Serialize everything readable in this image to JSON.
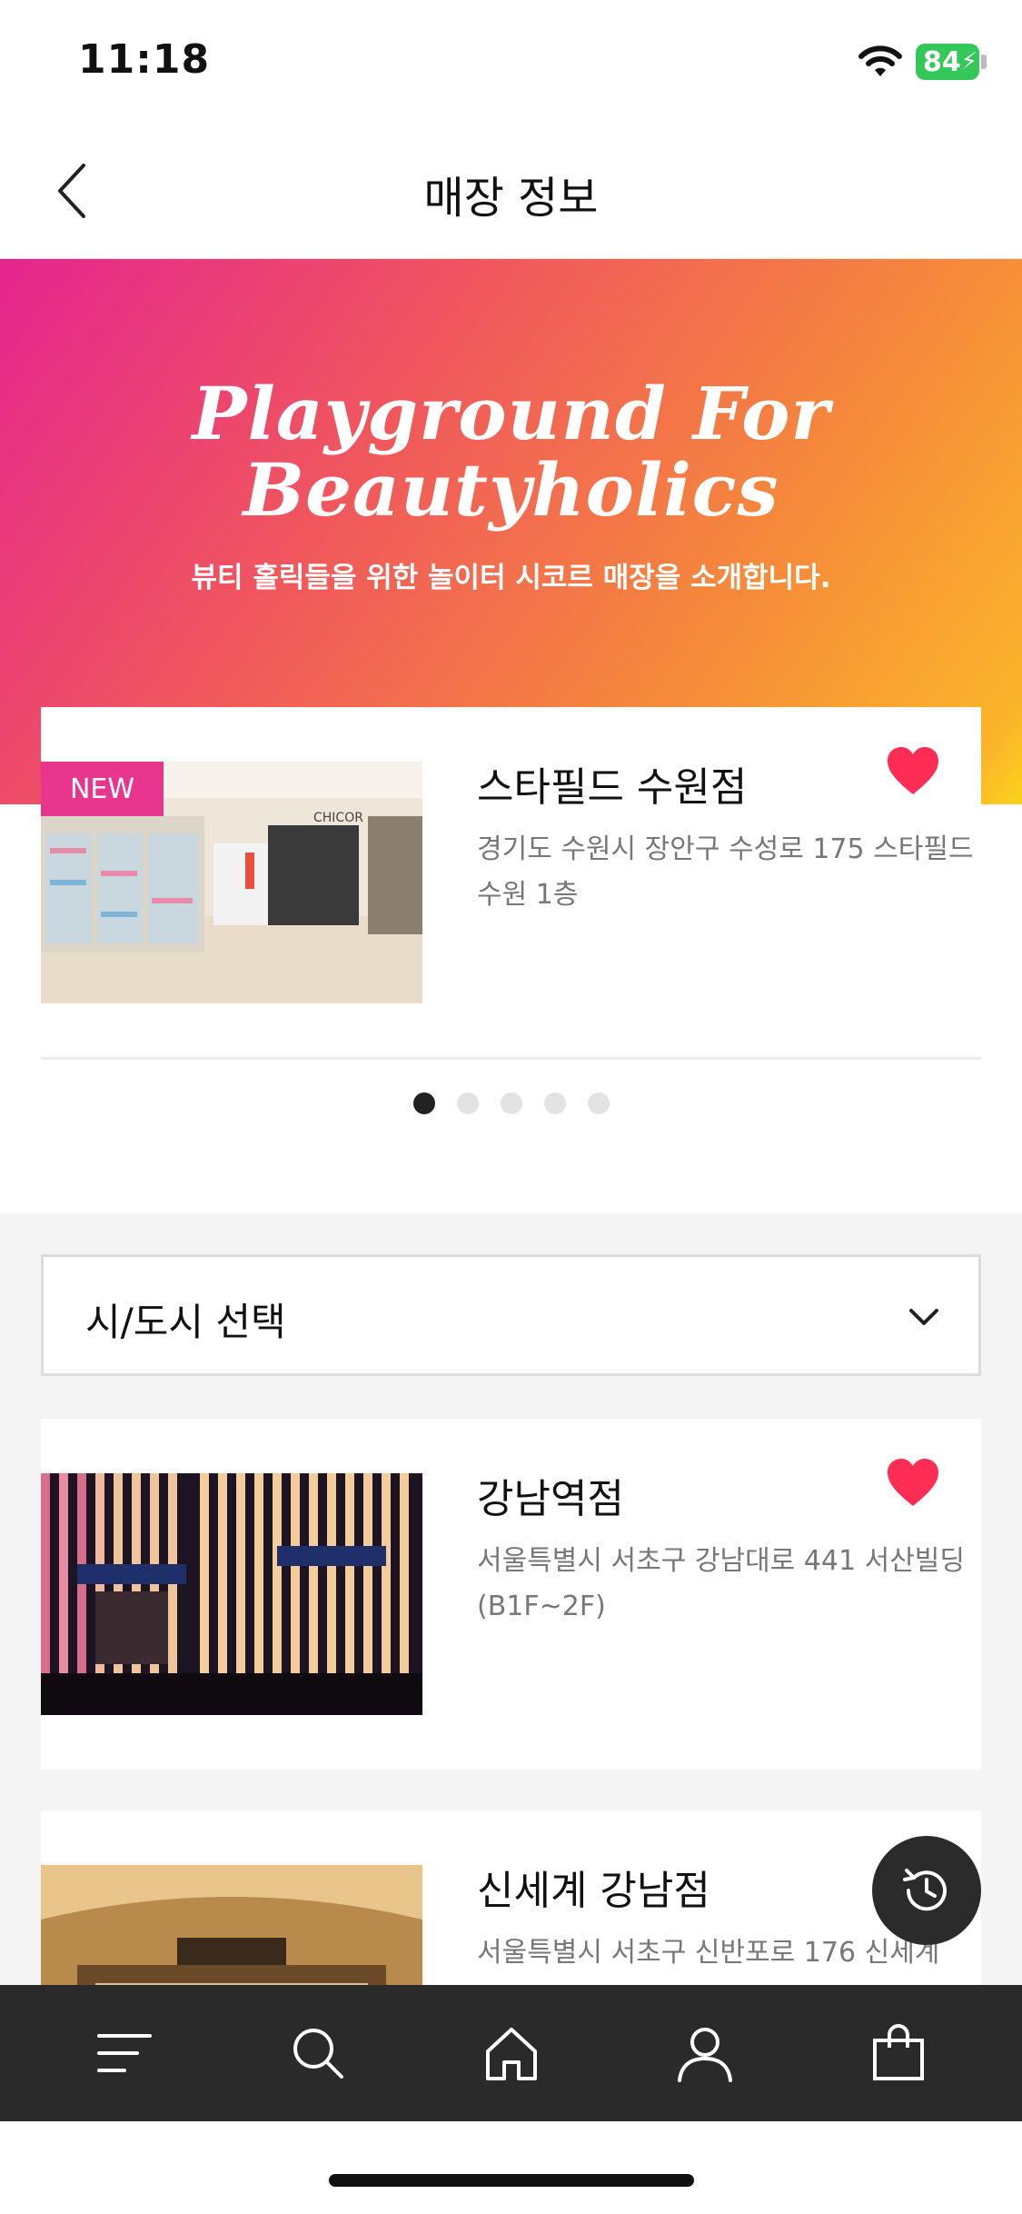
{
  "status_bar": {
    "time": "11:18",
    "battery": "84"
  },
  "header": {
    "title": "매장 정보",
    "back_icon": "chevron-left-icon"
  },
  "hero": {
    "headline_line1": "Playground For",
    "headline_line2": "Beautyholics",
    "subtitle": "뷰티 홀릭들을 위한 놀이터 시코르 매장을 소개합니다."
  },
  "featured": {
    "badge": "NEW",
    "name": "스타필드 수원점",
    "address": "경기도 수원시 장안구 수성로 175 스타필드 수원 1층",
    "favorited": true
  },
  "carousel": {
    "total": 5,
    "active_index": 0
  },
  "city_select": {
    "label": "시/도시 선택"
  },
  "stores": [
    {
      "name": "강남역점",
      "address": "서울특별시 서초구 강남대로 441 서산빌딩 (B1F~2F)",
      "favorited": true
    },
    {
      "name": "신세계 강남점",
      "address": "서울특별시 서초구 신반포로 176 신세계",
      "favorited": false
    }
  ],
  "tab_bar": {
    "items": [
      "menu-icon",
      "search-icon",
      "home-icon",
      "user-icon",
      "shopping-bag-icon"
    ]
  },
  "colors": {
    "accent": "#e8368f",
    "heart": "#ff2d55",
    "tab_bg": "#2a2a2a"
  }
}
